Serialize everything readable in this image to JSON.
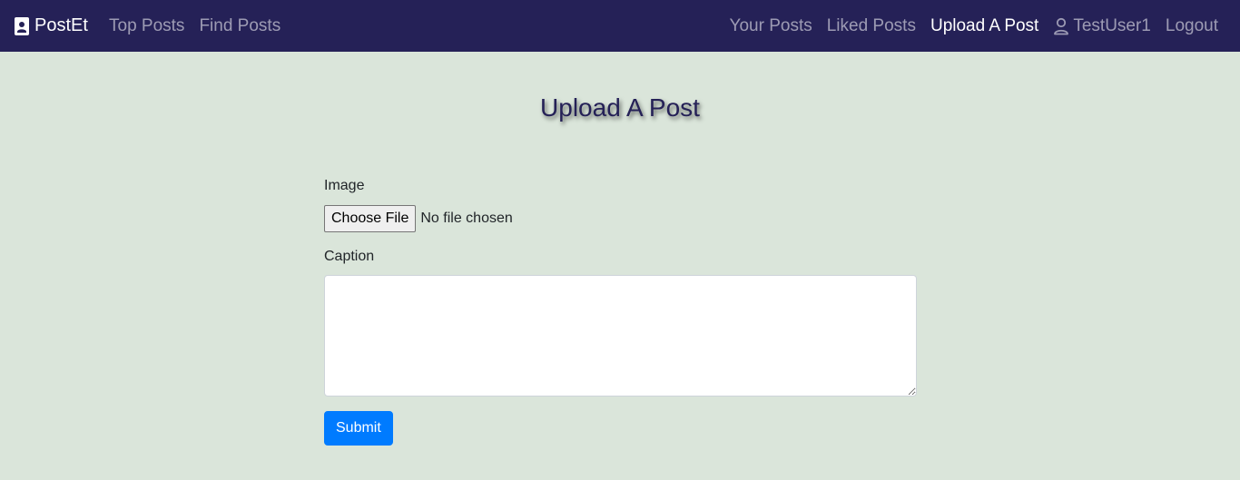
{
  "navbar": {
    "brand": "PostEt",
    "brand_icon": "contact-card-icon",
    "left_links": [
      {
        "label": "Top Posts"
      },
      {
        "label": "Find Posts"
      }
    ],
    "right_links": [
      {
        "label": "Your Posts"
      },
      {
        "label": "Liked Posts"
      },
      {
        "label": "Upload A Post",
        "active": true
      },
      {
        "label": "TestUser1",
        "icon": "user-icon"
      },
      {
        "label": "Logout"
      }
    ],
    "colors": {
      "background": "#252157",
      "link": "rgba(255,255,255,0.55)",
      "active_link": "#ffffff"
    }
  },
  "page": {
    "title": "Upload A Post",
    "background": "#dae5da"
  },
  "form": {
    "image_label": "Image",
    "file_button": "Choose File",
    "file_status": "No file chosen",
    "caption_label": "Caption",
    "caption_value": "",
    "submit_label": "Submit",
    "submit_color": "#007bff"
  }
}
